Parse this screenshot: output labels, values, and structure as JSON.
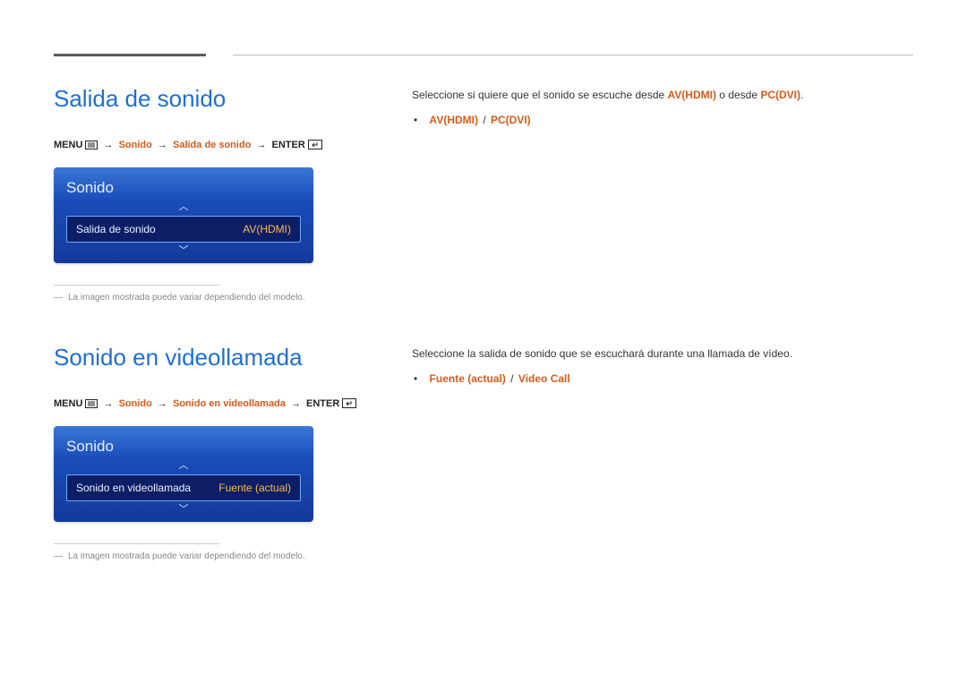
{
  "section1": {
    "title": "Salida de sonido",
    "path": {
      "menu_label": "MENU",
      "seg1": "Sonido",
      "seg2": "Salida de sonido",
      "enter_label": "ENTER"
    },
    "panel": {
      "title": "Sonido",
      "row_label": "Salida de sonido",
      "row_value": "AV(HDMI)"
    },
    "footnote": "La imagen mostrada puede variar dependiendo del modelo.",
    "desc_pre": "Seleccione si quiere que el sonido se escuche desde ",
    "desc_hl1": "AV(HDMI)",
    "desc_mid": " o desde ",
    "desc_hl2": "PC(DVI)",
    "desc_post": ".",
    "bullet_opt1": "AV(HDMI)",
    "bullet_sep": " / ",
    "bullet_opt2": "PC(DVI)"
  },
  "section2": {
    "title": "Sonido en videollamada",
    "path": {
      "menu_label": "MENU",
      "seg1": "Sonido",
      "seg2": "Sonido en videollamada",
      "enter_label": "ENTER"
    },
    "panel": {
      "title": "Sonido",
      "row_label": "Sonido en videollamada",
      "row_value": "Fuente (actual)"
    },
    "footnote": "La imagen mostrada puede variar dependiendo del modelo.",
    "desc": "Seleccione la salida de sonido que se escuchará durante una llamada de vídeo.",
    "bullet_opt1": "Fuente (actual)",
    "bullet_sep": " / ",
    "bullet_opt2": "Video Call"
  }
}
